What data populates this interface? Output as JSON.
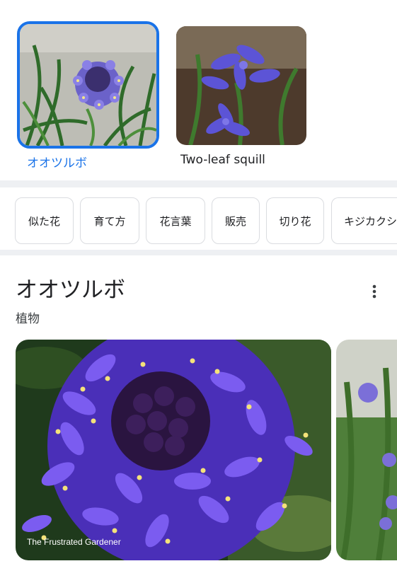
{
  "related": [
    {
      "label": "オオツルボ",
      "selected": true,
      "label_color": "#1a73e8"
    },
    {
      "label": "Two-leaf squill",
      "selected": false,
      "label_color": "#202124"
    }
  ],
  "chips": [
    "似た花",
    "育て方",
    "花言葉",
    "販売",
    "切り花",
    "キジカクシ"
  ],
  "entity": {
    "title": "オオツルボ",
    "subtitle": "植物",
    "more_icon": "more-vert-icon"
  },
  "hero": {
    "credit": "The Frustrated Gardener"
  },
  "colors": {
    "accent": "#1a73e8",
    "band": "#eef0f3",
    "chip_border": "#dadce0"
  }
}
